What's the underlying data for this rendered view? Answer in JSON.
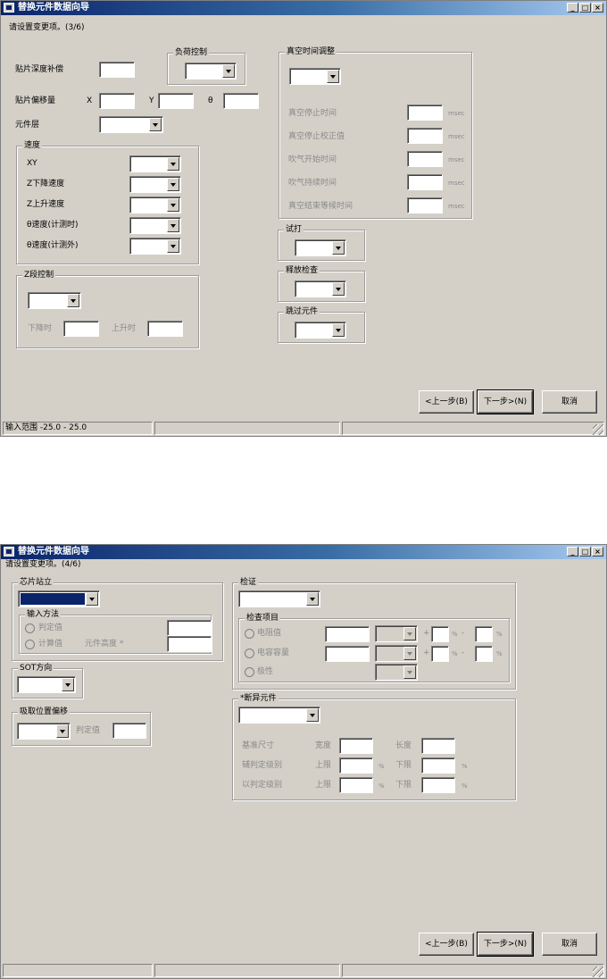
{
  "window_title": "替换元件数据向导",
  "titlebar_buttons": [
    "_",
    "□",
    "×"
  ],
  "step3": {
    "instruction": "请设置变更项。(3/6)",
    "mount_depth_label": "贴片深度补偿",
    "load_control_group": "负荷控制",
    "mount_offset_label": "贴片偏移量",
    "axis_x": "X",
    "axis_y": "Y",
    "axis_theta": "θ",
    "component_layer_label": "元件层",
    "speed_group": "速度",
    "speed_xy": "XY",
    "speed_z_down": "Z下降速度",
    "speed_z_up": "Z上升速度",
    "speed_theta_rec": "θ速度(计测时)",
    "speed_theta_other": "θ速度(计测外)",
    "z2_group": "Z段控制",
    "z2_down": "下降时",
    "z2_up": "上升时",
    "vacuum_group": "真空时间调整",
    "vacuum_stop": "真空停止时间",
    "vacuum_stop_correct": "真空停止校正值",
    "blow_start": "吹气开始时间",
    "blow_continue": "吹气持续时间",
    "vacuum_end_wait": "真空结束等候时间",
    "unit_msec": "msec",
    "trial_group": "试打",
    "release_group": "释放检查",
    "skip_group": "跳过元件",
    "status_text": "输入范围 -25.0 - 25.0"
  },
  "step4": {
    "instruction": "请设置变更项。(4/6)",
    "chip_standing_group": "芯片站立",
    "input_method_group": "输入方法",
    "judge_value": "判定值",
    "calc_value": "计算值",
    "component_height": "元件高度 *",
    "sot_group": "SOT方向",
    "pickup_offset_group": "吸取位置偏移",
    "pickup_judge": "判定值",
    "verify_group": "检证",
    "check_items_group": "检查项目",
    "resistance": "电阻值",
    "capacitance": "电容容量",
    "polarity": "极性",
    "plus": "+",
    "minus": "-",
    "percent": "%",
    "judge_group": "*断异元件",
    "base_size": "基准尺寸",
    "width": "宽度",
    "length": "长度",
    "level_a": "辅判定级别",
    "level_b": "以判定级别",
    "upper": "上限",
    "lower": "下限"
  },
  "buttons": {
    "back": "<上一步(B)",
    "next": "下一步>(N)",
    "cancel": "取消"
  }
}
